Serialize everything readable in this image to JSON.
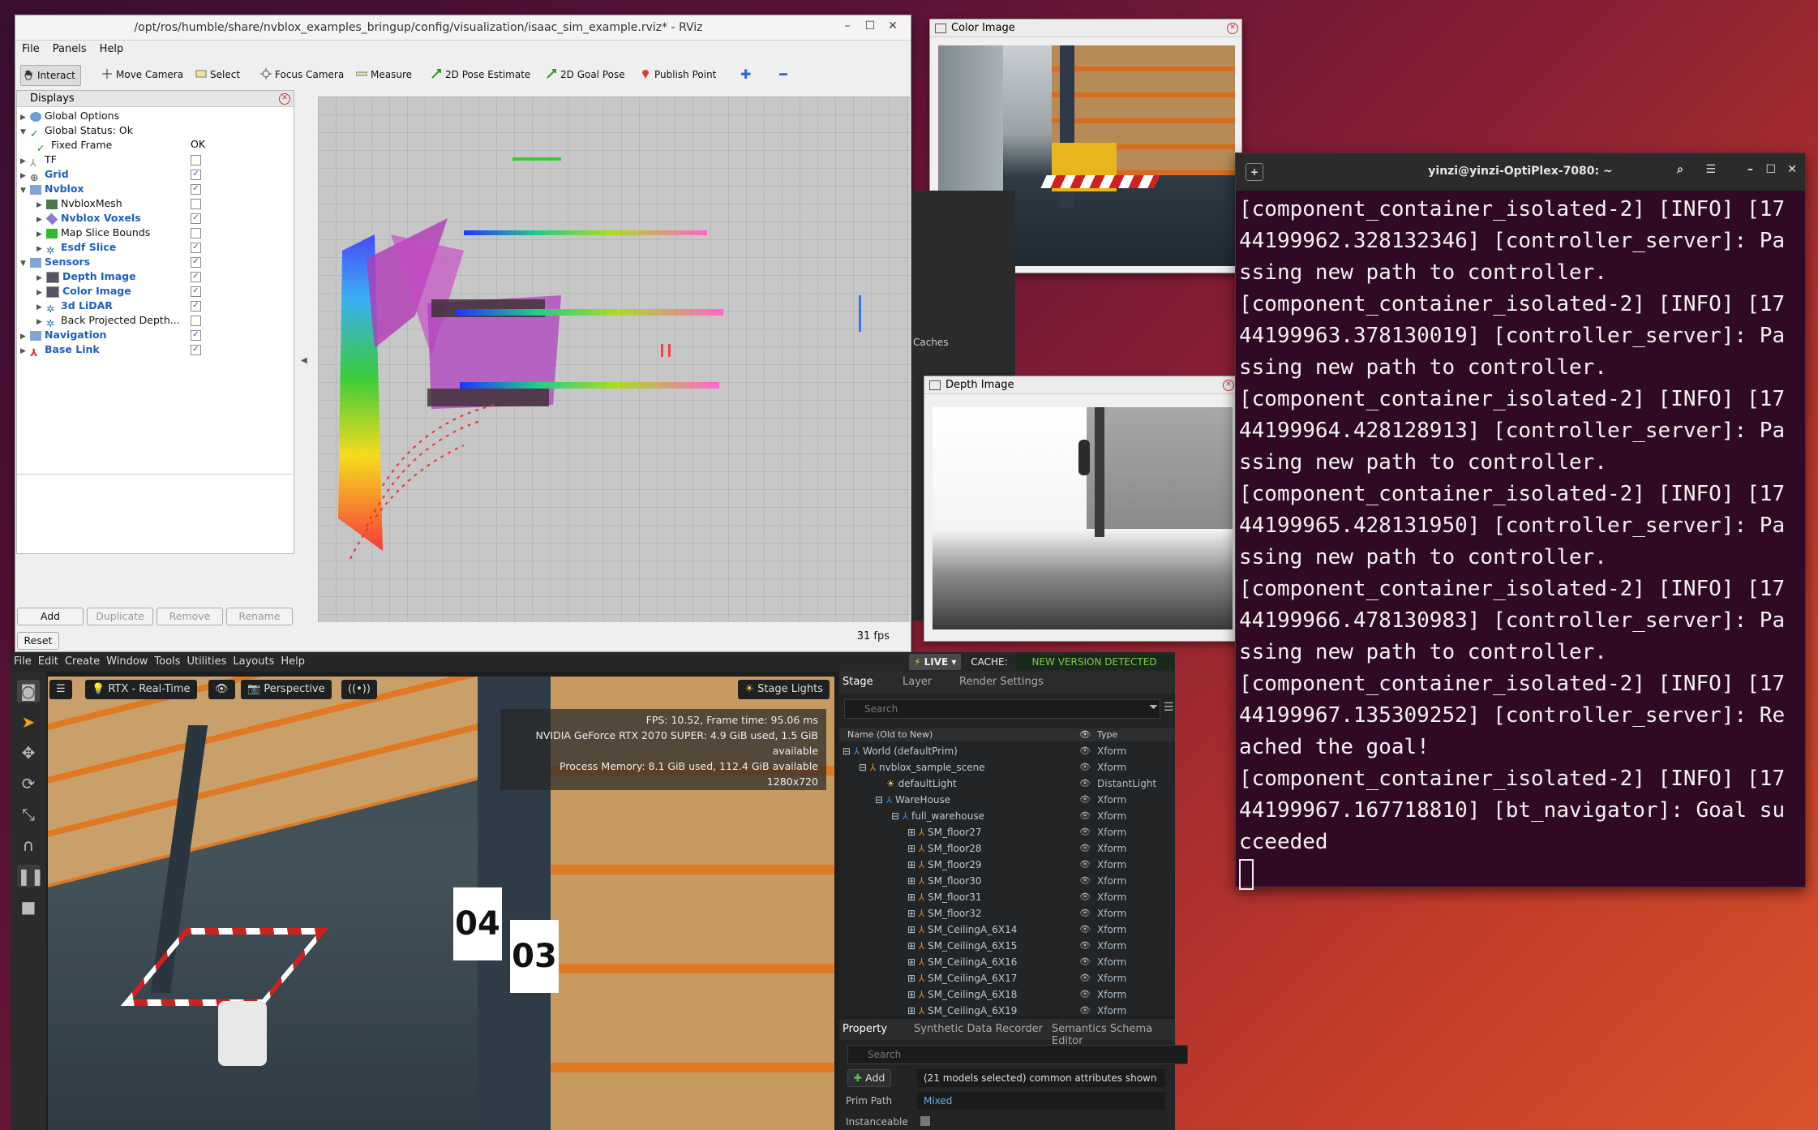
{
  "rviz": {
    "title": "/opt/ros/humble/share/nvblox_examples_bringup/config/visualization/isaac_sim_example.rviz* - RViz",
    "menu": [
      "File",
      "Panels",
      "Help"
    ],
    "tools": [
      "Interact",
      "Move Camera",
      "Select",
      "Focus Camera",
      "Measure",
      "2D Pose Estimate",
      "2D Goal Pose",
      "Publish Point"
    ],
    "displays_title": "Displays",
    "tree": [
      {
        "label": "Global Options",
        "checked": null
      },
      {
        "label": "Global Status: Ok",
        "checked": null
      },
      {
        "label": "Fixed Frame",
        "value": "OK"
      },
      {
        "label": "TF",
        "checked": false
      },
      {
        "label": "Grid",
        "checked": true
      },
      {
        "label": "Nvblox",
        "checked": true
      },
      {
        "label": "NvbloxMesh",
        "checked": false
      },
      {
        "label": "Nvblox Voxels",
        "checked": true
      },
      {
        "label": "Map Slice Bounds",
        "checked": false
      },
      {
        "label": "Esdf Slice",
        "checked": true
      },
      {
        "label": "Sensors",
        "checked": true
      },
      {
        "label": "Depth Image",
        "checked": true
      },
      {
        "label": "Color Image",
        "checked": true
      },
      {
        "label": "3d LiDAR",
        "checked": true
      },
      {
        "label": "Back Projected Depth...",
        "checked": false
      },
      {
        "label": "Navigation",
        "checked": true
      },
      {
        "label": "Base Link",
        "checked": true
      }
    ],
    "buttons": {
      "add": "Add",
      "duplicate": "Duplicate",
      "remove": "Remove",
      "rename": "Rename",
      "reset": "Reset"
    },
    "fps": "31 fps"
  },
  "color_image": {
    "title": "Color Image"
  },
  "depth_image": {
    "title": "Depth Image"
  },
  "caches_label": "Caches",
  "isaac": {
    "menu": [
      "File",
      "Edit",
      "Create",
      "Window",
      "Tools",
      "Utilities",
      "Layouts",
      "Help"
    ],
    "live": "LIVE",
    "cache": "CACHE:",
    "cache_status": "NEW VERSION DETECTED",
    "renderer": "RTX - Real-Time",
    "camera": "Perspective",
    "stage_lights": "Stage Lights",
    "stats": [
      "FPS: 10.52, Frame time: 95.06 ms",
      "NVIDIA GeForce RTX 2070 SUPER: 4.9 GiB used, 1.5 GiB available",
      "Process Memory: 8.1 GiB used, 112.4 GiB available",
      "1280x720"
    ],
    "stage_tabs": [
      "Stage",
      "Layer",
      "Render Settings"
    ],
    "search_placeholder": "Search",
    "col_name": "Name (Old to New)",
    "col_type": "Type",
    "stage_rows": [
      {
        "name": "World (defaultPrim)",
        "type": "Xform"
      },
      {
        "name": "nvblox_sample_scene",
        "type": "Xform"
      },
      {
        "name": "defaultLight",
        "type": "DistantLight"
      },
      {
        "name": "WareHouse",
        "type": "Xform"
      },
      {
        "name": "full_warehouse",
        "type": "Xform"
      },
      {
        "name": "SM_floor27",
        "type": "Xform"
      },
      {
        "name": "SM_floor28",
        "type": "Xform"
      },
      {
        "name": "SM_floor29",
        "type": "Xform"
      },
      {
        "name": "SM_floor30",
        "type": "Xform"
      },
      {
        "name": "SM_floor31",
        "type": "Xform"
      },
      {
        "name": "SM_floor32",
        "type": "Xform"
      },
      {
        "name": "SM_CeilingA_6X14",
        "type": "Xform"
      },
      {
        "name": "SM_CeilingA_6X15",
        "type": "Xform"
      },
      {
        "name": "SM_CeilingA_6X16",
        "type": "Xform"
      },
      {
        "name": "SM_CeilingA_6X17",
        "type": "Xform"
      },
      {
        "name": "SM_CeilingA_6X18",
        "type": "Xform"
      },
      {
        "name": "SM_CeilingA_6X19",
        "type": "Xform"
      }
    ],
    "prop_tabs": [
      "Property",
      "Synthetic Data Recorder",
      "Semantics Schema Editor"
    ],
    "add_label": "Add",
    "selection_info": "(21 models selected) common attributes shown",
    "prim_path_label": "Prim Path",
    "prim_path_value": "Mixed",
    "instanceable_label": "Instanceable",
    "rack_labels": [
      "04",
      "03"
    ]
  },
  "terminal": {
    "title": "yinzi@yinzi-OptiPlex-7080: ~",
    "lines": [
      "[component_container_isolated-2] [INFO] [17",
      "44199962.328132346] [controller_server]: Pa",
      "ssing new path to controller.",
      "[component_container_isolated-2] [INFO] [17",
      "44199963.378130019] [controller_server]: Pa",
      "ssing new path to controller.",
      "[component_container_isolated-2] [INFO] [17",
      "44199964.428128913] [controller_server]: Pa",
      "ssing new path to controller.",
      "[component_container_isolated-2] [INFO] [17",
      "44199965.428131950] [controller_server]: Pa",
      "ssing new path to controller.",
      "[component_container_isolated-2] [INFO] [17",
      "44199966.478130983] [controller_server]: Pa",
      "ssing new path to controller.",
      "[component_container_isolated-2] [INFO] [17",
      "44199967.135309252] [controller_server]: Re",
      "ached the goal!",
      "[component_container_isolated-2] [INFO] [17",
      "44199967.167718810] [bt_navigator]: Goal su",
      "cceeded"
    ]
  }
}
